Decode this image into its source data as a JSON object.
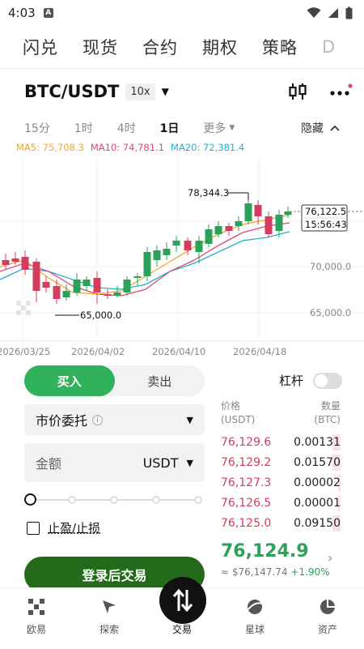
{
  "status": {
    "time": "4:03",
    "a_icon": "A"
  },
  "top_tabs": [
    {
      "label": "闪兑",
      "faded": false
    },
    {
      "label": "现货",
      "faded": false
    },
    {
      "label": "合约",
      "faded": false
    },
    {
      "label": "期权",
      "faded": false
    },
    {
      "label": "策略",
      "faded": false
    },
    {
      "label": "D",
      "faded": true
    }
  ],
  "pair": {
    "name": "BTC/USDT",
    "leverage": "10x"
  },
  "timeframes": [
    {
      "label": "15分",
      "active": false
    },
    {
      "label": "1时",
      "active": false
    },
    {
      "label": "4时",
      "active": false
    },
    {
      "label": "1日",
      "active": true
    }
  ],
  "tf_more": "更多",
  "tf_hide": "隐藏",
  "ma": {
    "ma5": "MA5: 75,708.3",
    "ma10": "MA10: 74,781.1",
    "ma20": "MA20: 72,381.4",
    "ma5_color": "#f5a623",
    "ma10_color": "#e0457b",
    "ma20_color": "#22b0d0"
  },
  "chart_data": {
    "type": "candlestick",
    "y_ticks": [
      "70,000.0",
      "65,000.0"
    ],
    "x_ticks": [
      "2026/03/25",
      "2026/04/02",
      "2026/04/10",
      "2026/04/18"
    ],
    "high_label": "78,344.3",
    "low_label": "65,000.0",
    "last_price_label": "76,122.5",
    "countdown_label": "15:56:43",
    "up_color": "#2ba15a",
    "down_color": "#d43d5e"
  },
  "trade": {
    "buy_label": "买入",
    "sell_label": "卖出",
    "leverage_label": "杠杆",
    "order_type": "市价委托",
    "amount_label": "金额",
    "amount_unit": "USDT",
    "tpsl_label": "止盈/止损",
    "login_button": "登录后交易"
  },
  "book": {
    "price_header": "价格",
    "price_unit": "(USDT)",
    "qty_header": "数量",
    "qty_unit": "(BTC)",
    "asks": [
      {
        "price": "76,129.6",
        "qty": "0.00131",
        "depth": 0.1
      },
      {
        "price": "76,129.2",
        "qty": "0.01570",
        "depth": 0.1
      },
      {
        "price": "76,127.3",
        "qty": "0.00002",
        "depth": 0.02
      },
      {
        "price": "76,126.5",
        "qty": "0.00001",
        "depth": 0.02
      },
      {
        "price": "76,125.0",
        "qty": "0.09150",
        "depth": 0.1
      }
    ],
    "last_price": "76,124.9",
    "last_usd": "≈ $76,147.74",
    "last_change": "+1.90%"
  },
  "nav": [
    {
      "label": "欧易",
      "icon": "okx-logo-icon"
    },
    {
      "label": "探索",
      "icon": "compass-icon"
    },
    {
      "label": "交易",
      "icon": "swap-icon"
    },
    {
      "label": "星球",
      "icon": "planet-icon"
    },
    {
      "label": "资产",
      "icon": "pie-chart-icon"
    }
  ]
}
